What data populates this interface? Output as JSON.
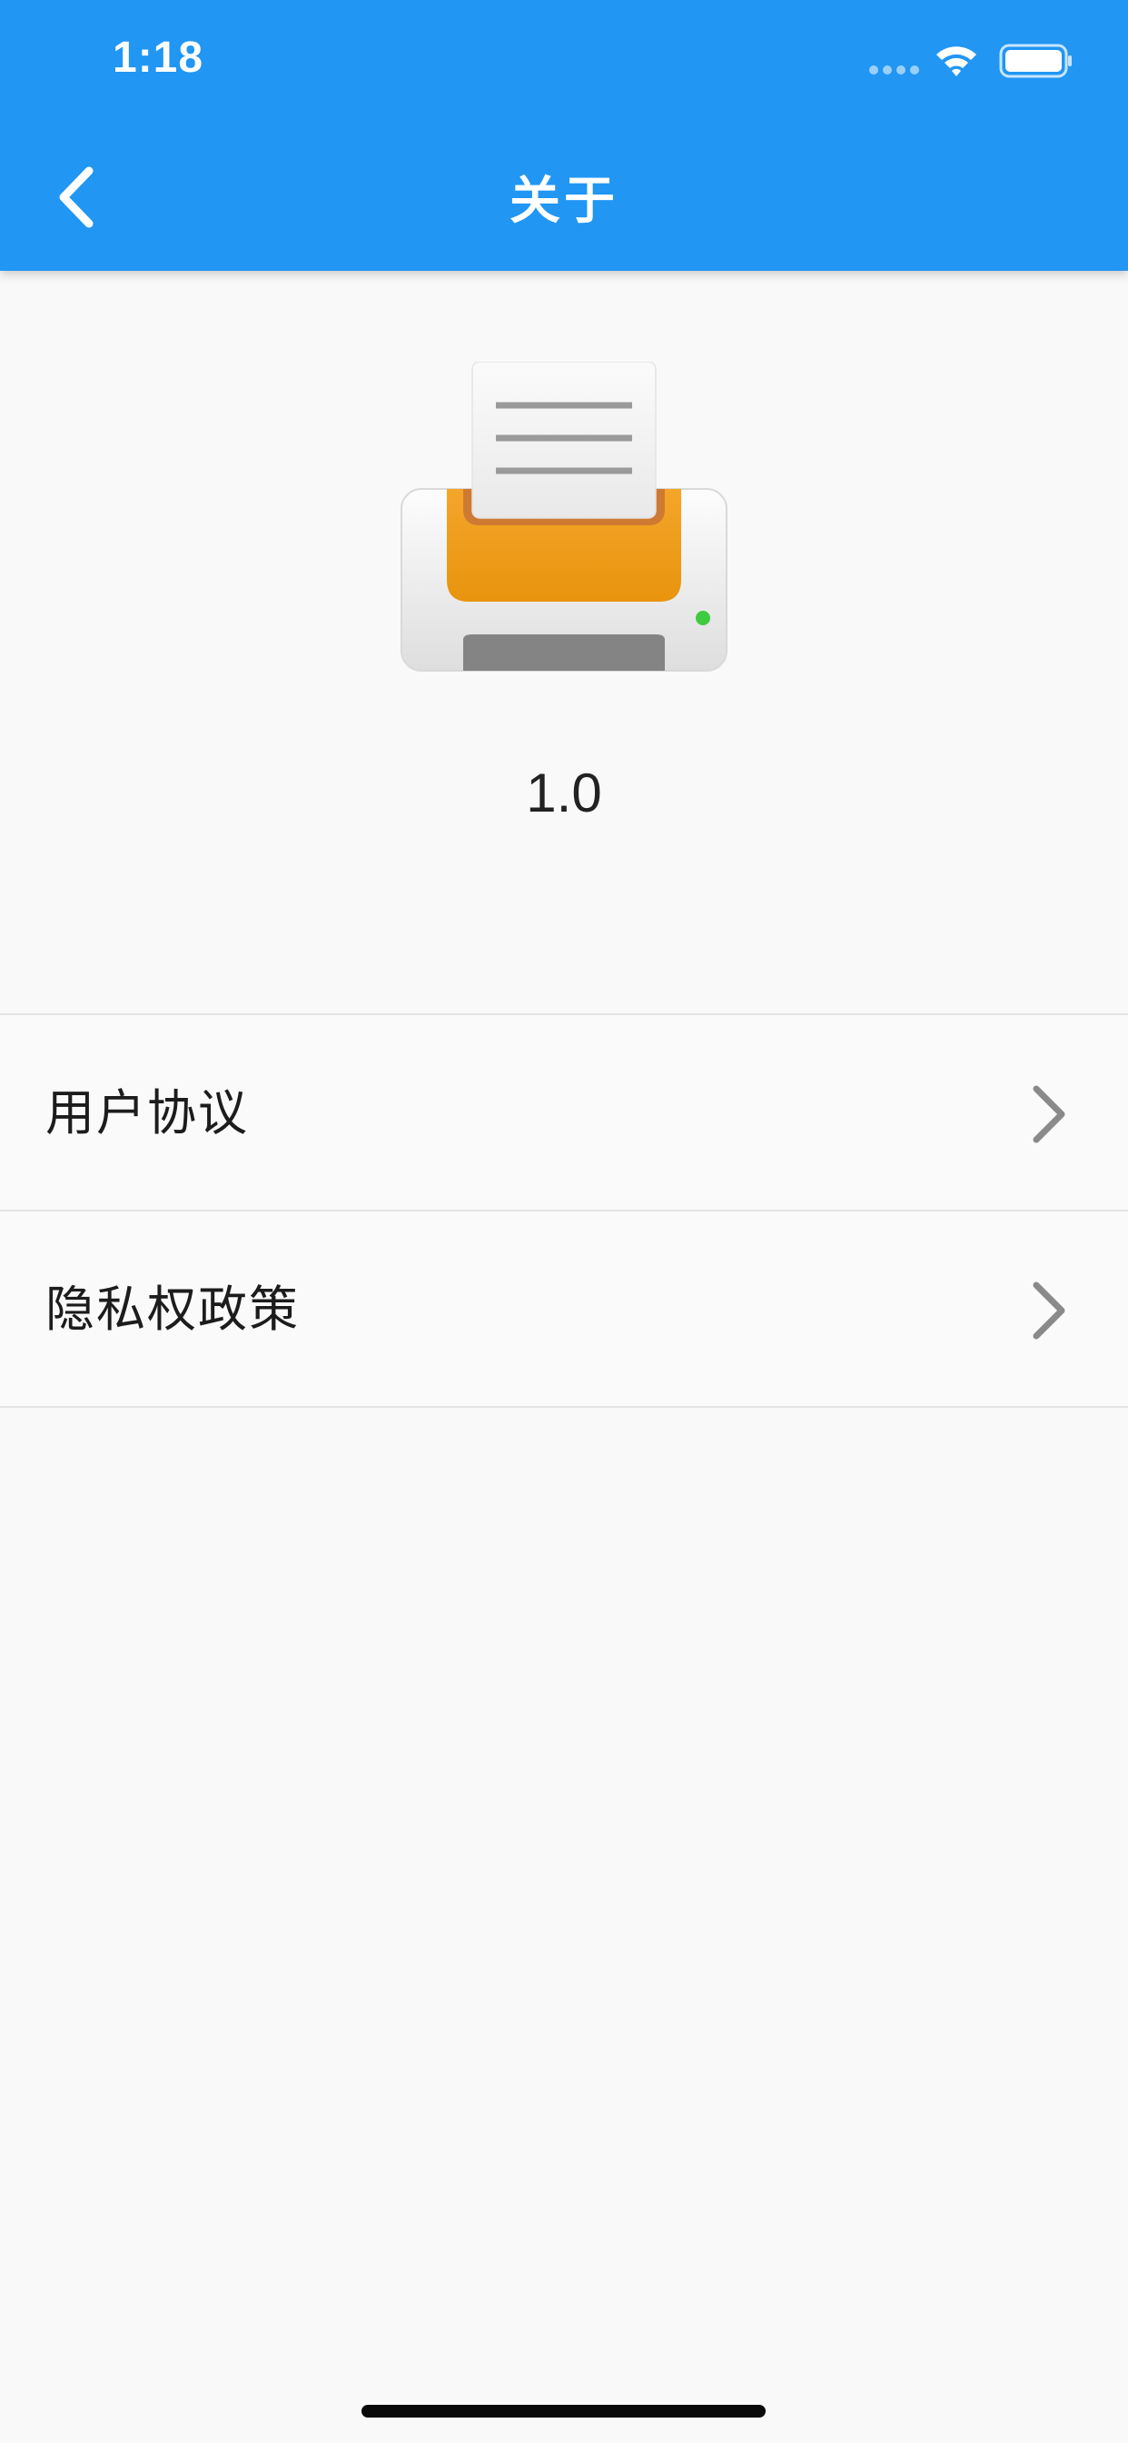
{
  "status_bar": {
    "time": "1:18"
  },
  "header": {
    "title": "关于",
    "back_icon": "chevron-left-icon"
  },
  "app": {
    "logo_icon": "printer-icon",
    "version": "1.0"
  },
  "menu": {
    "items": [
      {
        "label": "用户协议",
        "icon": "chevron-right-icon"
      },
      {
        "label": "隐私权政策",
        "icon": "chevron-right-icon"
      }
    ]
  },
  "colors": {
    "header_bg": "#2196f3",
    "page_bg": "#f9f9f9",
    "printer_orange": "#f0a020",
    "status_led": "#3ecc3e"
  }
}
